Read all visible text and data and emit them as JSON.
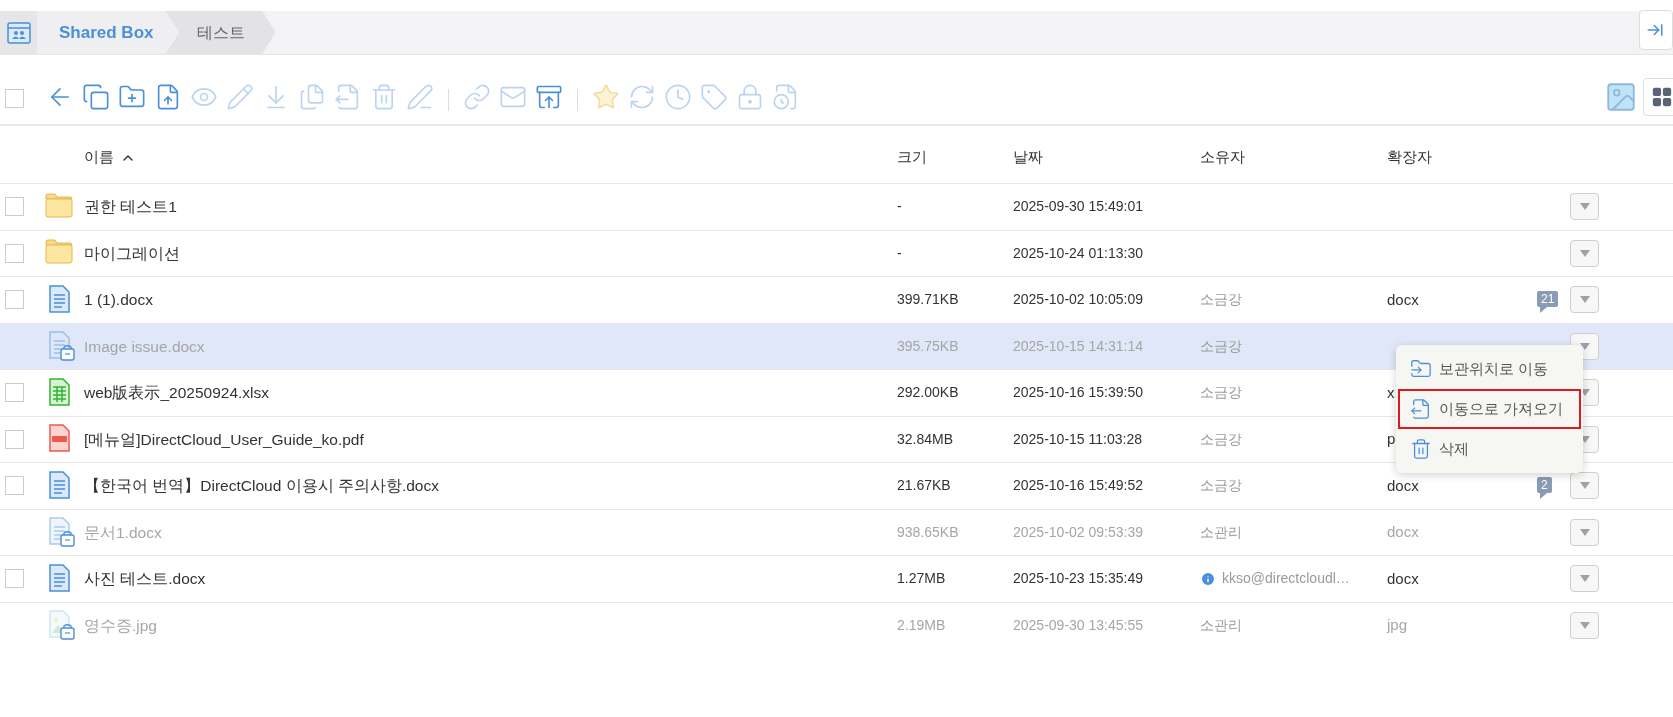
{
  "select_all": {
    "checked": false
  },
  "breadcrumb": [
    {
      "label": "Shared Box",
      "selected": false
    },
    {
      "label": "테스트",
      "selected": true
    }
  ],
  "toolbar": [
    {
      "disabled": false
    },
    {
      "disabled": false
    },
    {
      "disabled": false
    },
    {
      "disabled": false
    },
    {
      "disabled": true
    },
    {
      "disabled": true
    },
    {
      "disabled": true
    },
    {
      "disabled": true
    },
    {
      "disabled": true
    },
    {
      "disabled": true
    },
    {
      "disabled": true
    },
    {
      "disabled": true
    },
    {
      "disabled": true
    },
    {
      "disabled": false
    },
    {
      "disabled": true
    },
    {
      "disabled": true
    },
    {
      "disabled": true
    },
    {
      "disabled": true
    },
    {
      "disabled": true
    },
    {
      "disabled": true
    }
  ],
  "columns": [
    {
      "label": "이름",
      "sorted": true
    },
    {
      "label": "크기",
      "sorted": false
    },
    {
      "label": "날짜",
      "sorted": false
    },
    {
      "label": "소유자",
      "sorted": false
    },
    {
      "label": "확장자",
      "sorted": false
    }
  ],
  "rows": [
    {
      "kind": "folder",
      "name": "권한 테스트1",
      "size": "-",
      "date": "2025-09-30 15:49:01",
      "locked": false,
      "selected": false
    },
    {
      "kind": "folder",
      "name": "마이그레이션",
      "size": "-",
      "date": "2025-10-24 01:13:30",
      "locked": false,
      "selected": false
    },
    {
      "kind": "doc",
      "name": "1 (1).docx",
      "size": "399.71KB",
      "date": "2025-10-02 10:05:09",
      "owner": "소금강",
      "ext": "docx",
      "comments": "21",
      "locked": false,
      "selected": false
    },
    {
      "kind": "doc",
      "name": "Image issue.docx",
      "size": "395.75KB",
      "date": "2025-10-15 14:31:14",
      "owner": "소금강",
      "locked": true,
      "selected": true
    },
    {
      "kind": "sheet",
      "name": "web版表示_20250924.xlsx",
      "size": "292.00KB",
      "date": "2025-10-16 15:39:50",
      "owner": "소금강",
      "ext": "x",
      "locked": false,
      "selected": false
    },
    {
      "kind": "pdf",
      "name": "[메뉴얼]DirectCloud_User_Guide_ko.pdf",
      "size": "32.84MB",
      "date": "2025-10-15 11:03:28",
      "owner": "소금강",
      "ext": "p",
      "locked": false,
      "selected": false
    },
    {
      "kind": "doc",
      "name": "【한국어 번역】DirectCloud 이용시 주의사항.docx",
      "size": "21.67KB",
      "date": "2025-10-16 15:49:52",
      "owner": "소금강",
      "ext": "docx",
      "comments": "2",
      "locked": false,
      "selected": false
    },
    {
      "kind": "doc",
      "name": "문서1.docx",
      "size": "938.65KB",
      "date": "2025-10-02 09:53:39",
      "owner": "소관리",
      "ext": "docx",
      "locked": true,
      "selected": false
    },
    {
      "kind": "doc",
      "name": "사진 테스트.docx",
      "size": "1.27MB",
      "date": "2025-10-23 15:35:49",
      "owner": "kkso@directcloudl…",
      "owner_info": true,
      "ext": "docx",
      "locked": false,
      "selected": false
    },
    {
      "kind": "image",
      "name": "영수증.jpg",
      "size": "2.19MB",
      "date": "2025-09-30 13:45:55",
      "owner": "소관리",
      "ext": "jpg",
      "locked": true,
      "selected": false
    }
  ],
  "context_menu": [
    {
      "kind": "move",
      "label": "보관위치로 이동",
      "selected": false
    },
    {
      "kind": "import",
      "label": "이동으로 가져오기",
      "selected": true
    },
    {
      "kind": "delete",
      "label": "삭제",
      "selected": false
    }
  ]
}
